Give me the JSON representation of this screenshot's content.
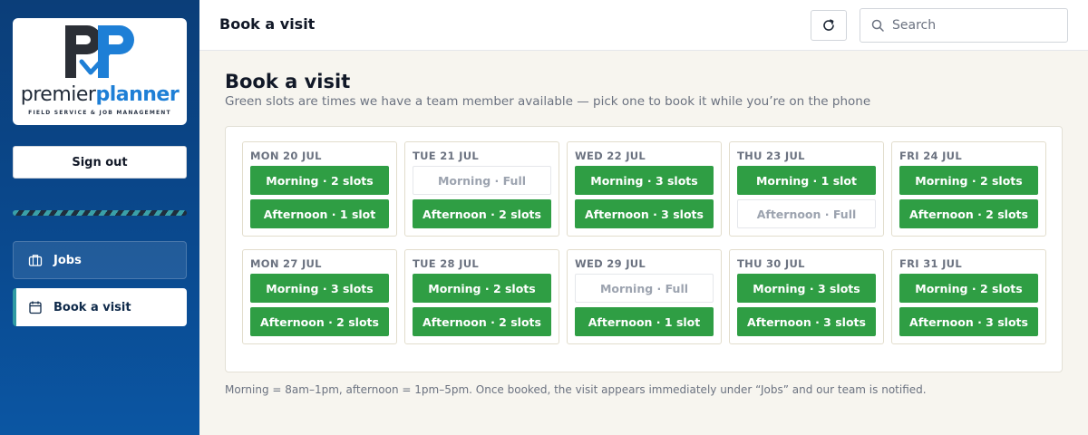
{
  "brand": {
    "word1": "premier",
    "word2": "planner",
    "tagline": "FIELD SERVICE & JOB MANAGEMENT"
  },
  "sidebar": {
    "signout_label": "Sign out",
    "items": [
      {
        "label": "Jobs",
        "icon": "briefcase-icon"
      },
      {
        "label": "Book a visit",
        "icon": "calendar-icon"
      }
    ]
  },
  "header": {
    "title": "Book a visit",
    "search_placeholder": "Search"
  },
  "main": {
    "title": "Book a visit",
    "subtitle": "Green slots are times we have a team member available — pick one to book it while you’re on the phone",
    "footnote": "Morning = 8am–1pm, afternoon = 1pm–5pm. Once booked, the visit appears immediately under “Jobs” and our team is notified."
  },
  "colors": {
    "available": "#2f9e44",
    "sidebar": "#0b3e79",
    "accent": "#1e7fd6"
  },
  "days": [
    {
      "label": "MON 20 JUL",
      "morning": "Morning · 2 slots",
      "afternoon": "Afternoon · 1 slot",
      "morning_full": false,
      "afternoon_full": false
    },
    {
      "label": "TUE 21 JUL",
      "morning": "Morning · Full",
      "afternoon": "Afternoon · 2 slots",
      "morning_full": true,
      "afternoon_full": false
    },
    {
      "label": "WED 22 JUL",
      "morning": "Morning · 3 slots",
      "afternoon": "Afternoon · 3 slots",
      "morning_full": false,
      "afternoon_full": false
    },
    {
      "label": "THU 23 JUL",
      "morning": "Morning · 1 slot",
      "afternoon": "Afternoon · Full",
      "morning_full": false,
      "afternoon_full": true
    },
    {
      "label": "FRI 24 JUL",
      "morning": "Morning · 2 slots",
      "afternoon": "Afternoon · 2 slots",
      "morning_full": false,
      "afternoon_full": false
    },
    {
      "label": "MON 27 JUL",
      "morning": "Morning · 3 slots",
      "afternoon": "Afternoon · 2 slots",
      "morning_full": false,
      "afternoon_full": false
    },
    {
      "label": "TUE 28 JUL",
      "morning": "Morning · 2 slots",
      "afternoon": "Afternoon · 2 slots",
      "morning_full": false,
      "afternoon_full": false
    },
    {
      "label": "WED 29 JUL",
      "morning": "Morning · Full",
      "afternoon": "Afternoon · 1 slot",
      "morning_full": true,
      "afternoon_full": false
    },
    {
      "label": "THU 30 JUL",
      "morning": "Morning · 3 slots",
      "afternoon": "Afternoon · 3 slots",
      "morning_full": false,
      "afternoon_full": false
    },
    {
      "label": "FRI 31 JUL",
      "morning": "Morning · 2 slots",
      "afternoon": "Afternoon · 3 slots",
      "morning_full": false,
      "afternoon_full": false
    }
  ]
}
